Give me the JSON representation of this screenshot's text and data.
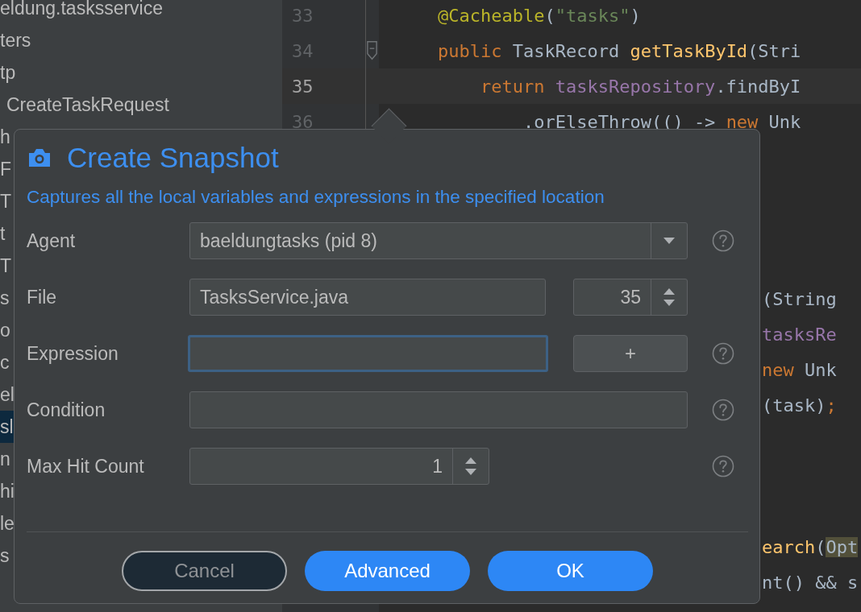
{
  "project_tree": {
    "items": [
      {
        "label": "eldung.tasksservice",
        "selected": false
      },
      {
        "label": "ters",
        "selected": false
      },
      {
        "label": "tp",
        "selected": false
      },
      {
        "label": "CreateTaskRequest",
        "selected": false
      },
      {
        "label": "h",
        "selected": false
      },
      {
        "label": "F",
        "selected": false
      },
      {
        "label": "T",
        "selected": false
      },
      {
        "label": "t",
        "selected": false
      },
      {
        "label": "T",
        "selected": false
      },
      {
        "label": "s",
        "selected": false
      },
      {
        "label": "o",
        "selected": false
      },
      {
        "label": "c",
        "selected": false
      },
      {
        "label": "el",
        "selected": false
      },
      {
        "label": "sl",
        "selected": true
      },
      {
        "label": "n",
        "selected": false
      },
      {
        "label": "hi",
        "selected": false
      },
      {
        "label": "le",
        "selected": false
      },
      {
        "label": "s",
        "selected": false
      }
    ]
  },
  "editor": {
    "lines": [
      {
        "number": "33",
        "current": false,
        "fold": false,
        "tokens": [
          {
            "text": "@Cacheable",
            "kind": "annotation"
          },
          {
            "text": "(",
            "kind": "plain"
          },
          {
            "text": "\"tasks\"",
            "kind": "string"
          },
          {
            "text": ")",
            "kind": "plain"
          }
        ]
      },
      {
        "number": "34",
        "current": false,
        "fold": true,
        "tokens": [
          {
            "text": "public ",
            "kind": "keyword"
          },
          {
            "text": "TaskRecord ",
            "kind": "plain"
          },
          {
            "text": "getTaskById",
            "kind": "method"
          },
          {
            "text": "(Stri",
            "kind": "plain"
          }
        ]
      },
      {
        "number": "35",
        "current": true,
        "fold": false,
        "tokens": [
          {
            "text": "return ",
            "kind": "keyword"
          },
          {
            "text": "tasksRepository",
            "kind": "field"
          },
          {
            "text": ".findByI",
            "kind": "plain"
          }
        ]
      },
      {
        "number": "36",
        "current": false,
        "fold": false,
        "tokens": [
          {
            "text": ".orElseThrow(() -> ",
            "kind": "plain"
          },
          {
            "text": "new ",
            "kind": "keyword"
          },
          {
            "text": "Unk",
            "kind": "plain"
          }
        ]
      }
    ],
    "visible_fragments": [
      {
        "tokens": [
          {
            "text": "(String",
            "kind": "plain"
          }
        ]
      },
      {
        "tokens": [
          {
            "text": "tasksRe",
            "kind": "field"
          }
        ]
      },
      {
        "tokens": [
          {
            "text": "new ",
            "kind": "keyword"
          },
          {
            "text": "Unk",
            "kind": "plain"
          }
        ]
      },
      {
        "tokens": [
          {
            "text": "(task)",
            "kind": "plain"
          },
          {
            "text": ";",
            "kind": "keyword"
          }
        ]
      },
      {
        "tokens": [
          {
            "text": "earch",
            "kind": "method"
          },
          {
            "text": "(",
            "kind": "plain"
          },
          {
            "text": "Opt",
            "kind": "highlight"
          }
        ]
      },
      {
        "tokens": [
          {
            "text": "nt() && s",
            "kind": "plain"
          }
        ]
      }
    ]
  },
  "dialog": {
    "title": "Create Snapshot",
    "subtitle": "Captures all the local variables and expressions in the specified location",
    "fields": [
      {
        "kind": "combo",
        "label": "Agent",
        "value": "baeldungtasks (pid 8)",
        "help": true
      },
      {
        "kind": "file",
        "label": "File",
        "value": "TasksService.java",
        "line": "35",
        "help": false
      },
      {
        "kind": "expression",
        "label": "Expression",
        "focused": true,
        "button": "+",
        "help": true
      },
      {
        "kind": "text",
        "label": "Condition",
        "focused": false,
        "help": true
      },
      {
        "kind": "number",
        "label": "Max Hit Count",
        "value": "1",
        "help": true
      }
    ],
    "buttons": [
      {
        "label": "Cancel",
        "kind": "secondary"
      },
      {
        "label": "Advanced",
        "kind": "primary"
      },
      {
        "label": "OK",
        "kind": "primary"
      }
    ]
  }
}
